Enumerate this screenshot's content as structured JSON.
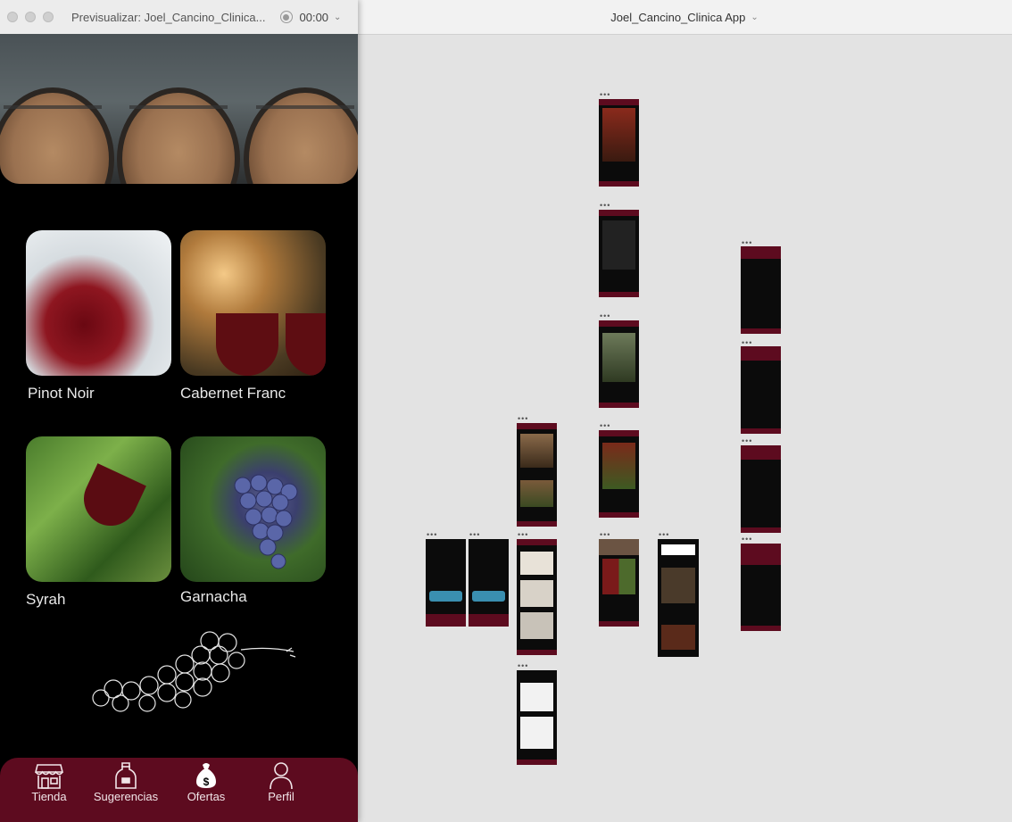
{
  "preview_window": {
    "title": "Previsualizar: Joel_Cancino_Clinica...",
    "timer": "00:00"
  },
  "main_window": {
    "title": "Joel_Cancino_Clinica App"
  },
  "varietals": [
    {
      "label": "Pinot Noir"
    },
    {
      "label": "Cabernet Franc"
    },
    {
      "label": "Syrah"
    },
    {
      "label": "Garnacha"
    }
  ],
  "tabbar": {
    "items": [
      {
        "label": "Tienda",
        "icon": "store-icon"
      },
      {
        "label": "Sugerencias",
        "icon": "bottle-icon"
      },
      {
        "label": "Ofertas",
        "icon": "money-bag-icon"
      },
      {
        "label": "Perfil",
        "icon": "user-icon"
      }
    ]
  },
  "artboards": {
    "more_glyph": "•••"
  },
  "colors": {
    "brand": "#5d0b1f",
    "background": "#000000",
    "canvas": "#e3e3e3"
  }
}
